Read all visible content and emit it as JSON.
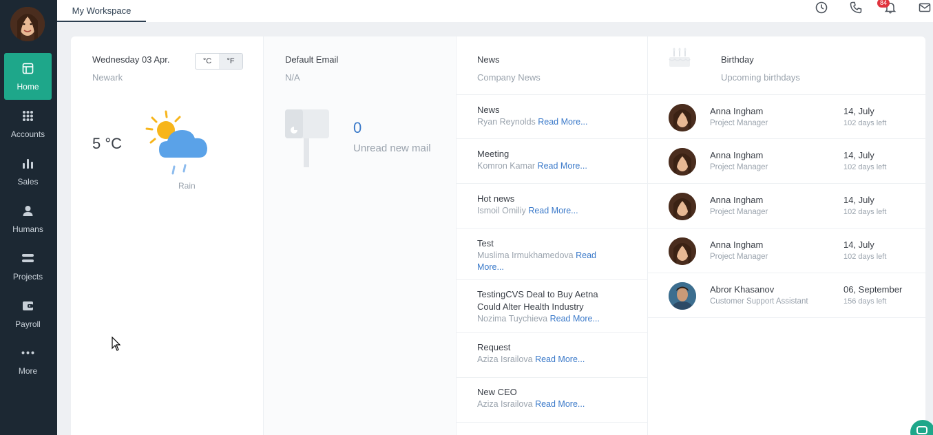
{
  "sidebar": {
    "items": [
      {
        "label": "Home",
        "icon": "home-icon"
      },
      {
        "label": "Accounts",
        "icon": "grid-icon"
      },
      {
        "label": "Sales",
        "icon": "bar-chart-icon"
      },
      {
        "label": "Humans",
        "icon": "person-icon"
      },
      {
        "label": "Projects",
        "icon": "projects-icon"
      },
      {
        "label": "Payroll",
        "icon": "wallet-icon"
      },
      {
        "label": "More",
        "icon": "more-icon"
      }
    ]
  },
  "topbar": {
    "tab_label": "My Workspace",
    "notification_count": "84"
  },
  "weather": {
    "date": "Wednesday 03 Apr.",
    "city": "Newark",
    "unit_c": "°C",
    "unit_f": "°F",
    "temp": "5 °C",
    "condition": "Rain"
  },
  "email": {
    "title": "Default Email",
    "address": "N/A",
    "count": "0",
    "count_label": "Unread new mail"
  },
  "news": {
    "title": "News",
    "subtitle": "Company News",
    "read_more": "Read More...",
    "items": [
      {
        "title": "News",
        "author": "Ryan Reynolds"
      },
      {
        "title": "Meeting",
        "author": "Komron Kamar"
      },
      {
        "title": "Hot news",
        "author": "Ismoil Omiliy"
      },
      {
        "title": "Test",
        "author": "Muslima Irmukhamedova"
      },
      {
        "title": "TestingCVS Deal to Buy Aetna Could Alter Health Industry",
        "author": "Nozima Tuychieva"
      },
      {
        "title": "Request",
        "author": "Aziza Israilova"
      },
      {
        "title": "New CEO",
        "author": "Aziza Israilova"
      }
    ]
  },
  "birthday": {
    "title": "Birthday",
    "subtitle": "Upcoming birthdays",
    "people": [
      {
        "name": "Anna Ingham",
        "role": "Project Manager",
        "date": "14, July",
        "left": "102 days left"
      },
      {
        "name": "Anna Ingham",
        "role": "Project Manager",
        "date": "14, July",
        "left": "102 days left"
      },
      {
        "name": "Anna Ingham",
        "role": "Project Manager",
        "date": "14, July",
        "left": "102 days left"
      },
      {
        "name": "Anna Ingham",
        "role": "Project Manager",
        "date": "14, July",
        "left": "102 days left"
      },
      {
        "name": "Abror Khasanov",
        "role": "Customer Support Assistant",
        "date": "06, September",
        "left": "156 days left"
      }
    ]
  },
  "colors": {
    "sidebar_bg": "#1c2833",
    "accent": "#1ea78a",
    "link": "#3a79c9",
    "badge": "#e0343e"
  }
}
